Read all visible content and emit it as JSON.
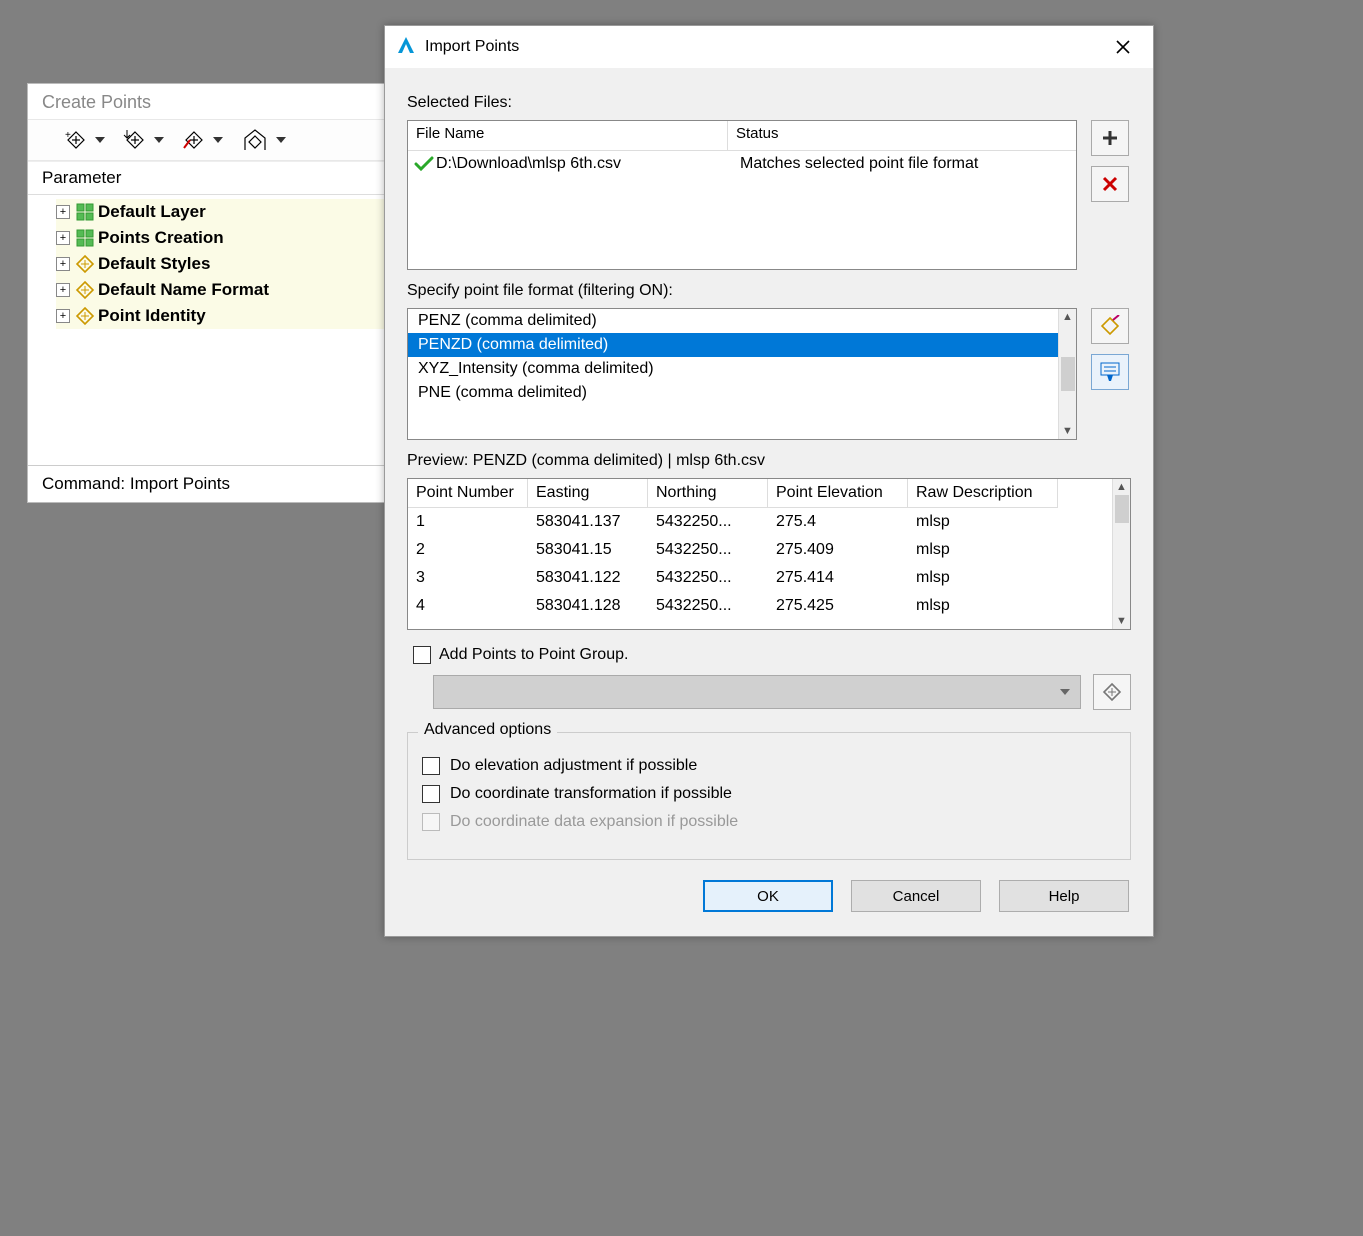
{
  "create_points": {
    "title": "Create Points",
    "param_header": "Parameter",
    "tree": [
      {
        "label": "Default Layer",
        "icon": "green"
      },
      {
        "label": "Points Creation",
        "icon": "green"
      },
      {
        "label": "Default Styles",
        "icon": "amber"
      },
      {
        "label": "Default Name Format",
        "icon": "amber"
      },
      {
        "label": "Point Identity",
        "icon": "amber"
      }
    ],
    "command_bar": "Command: Import Points"
  },
  "dialog": {
    "title": "Import Points",
    "selected_files_label": "Selected Files:",
    "file_columns": {
      "file": "File Name",
      "status": "Status"
    },
    "files": [
      {
        "name": "D:\\Download\\mlsp  6th.csv",
        "status": "Matches selected point file format"
      }
    ],
    "format_label": "Specify point file format (filtering ON):",
    "formats": [
      {
        "label": "PENZ (comma delimited)",
        "selected": false
      },
      {
        "label": "PENZD (comma delimited)",
        "selected": true
      },
      {
        "label": "XYZ_Intensity (comma delimited)",
        "selected": false
      },
      {
        "label": "PNE (comma delimited)",
        "selected": false
      }
    ],
    "preview_label": "Preview: PENZD (comma delimited) | mlsp  6th.csv",
    "preview_columns": {
      "pn": "Point Number",
      "e": "Easting",
      "n": "Northing",
      "el": "Point Elevation",
      "rd": "Raw Description"
    },
    "preview_rows": [
      {
        "pn": "1",
        "e": "583041.137",
        "n": "5432250...",
        "el": "275.4",
        "rd": "mlsp"
      },
      {
        "pn": "2",
        "e": "583041.15",
        "n": "5432250...",
        "el": "275.409",
        "rd": "mlsp"
      },
      {
        "pn": "3",
        "e": "583041.122",
        "n": "5432250...",
        "el": "275.414",
        "rd": "mlsp"
      },
      {
        "pn": "4",
        "e": "583041.128",
        "n": "5432250...",
        "el": "275.425",
        "rd": "mlsp"
      }
    ],
    "pg_checkbox": "Add Points to Point Group.",
    "advanced_legend": "Advanced options",
    "adv_opts": {
      "elev": "Do elevation adjustment if possible",
      "coord": "Do coordinate transformation if possible",
      "expand": "Do coordinate data expansion if possible"
    },
    "buttons": {
      "ok": "OK",
      "cancel": "Cancel",
      "help": "Help"
    }
  }
}
